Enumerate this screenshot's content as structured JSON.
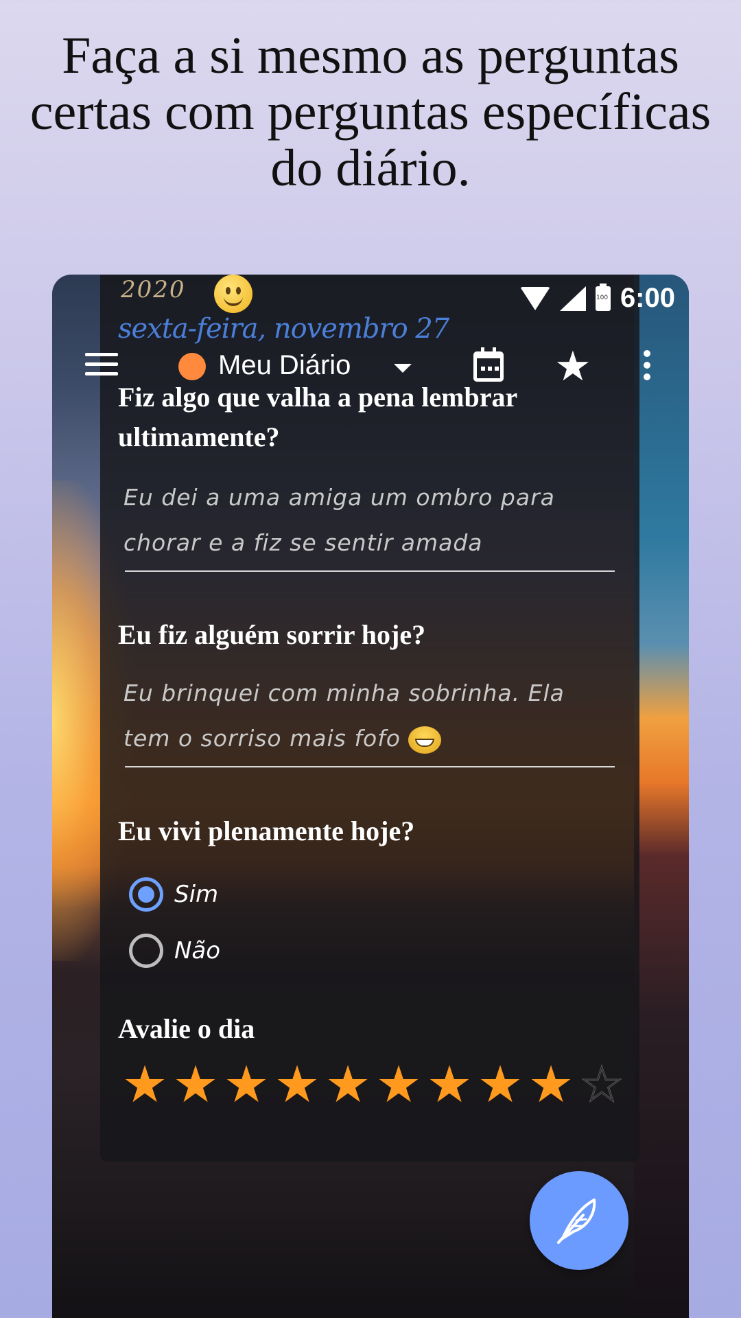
{
  "promo": {
    "title_line1": "Faça a si mesmo as perguntas",
    "title_line2": "certas com perguntas específicas",
    "title_line3": "do diário."
  },
  "statusbar": {
    "year": "2020",
    "battery": "100",
    "time": "6:00",
    "date": "sexta-feira, novembro 27"
  },
  "toolbar": {
    "diary_name": "Meu Diário",
    "diary_color": "#ff8a3d"
  },
  "entries": [
    {
      "question": "Fiz algo que valha a pena lembrar ultimamente?",
      "answer": "Eu dei a uma amiga um ombro para chorar e a fiz se sentir amada"
    },
    {
      "question": "Eu fiz alguém sorrir hoje?",
      "answer": "Eu brinquei com minha sobrinha. Ela tem o sorriso mais fofo"
    }
  ],
  "yes_no": {
    "question": "Eu vivi plenamente hoje?",
    "options": [
      "Sim",
      "Não"
    ],
    "selected": "Sim"
  },
  "rating": {
    "label": "Avalie o dia",
    "value": 9,
    "max": 10,
    "color": "#ff9a1f"
  },
  "fab": {
    "icon": "feather-icon",
    "color": "#6c9bff"
  }
}
